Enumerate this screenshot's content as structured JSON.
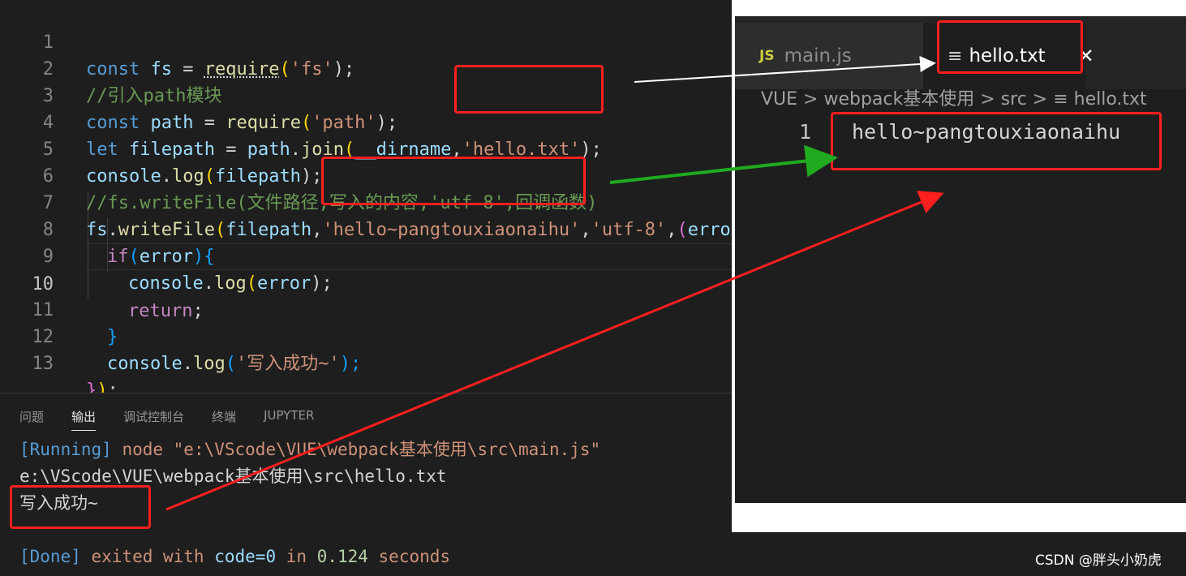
{
  "editor": {
    "line_numbers": [
      "1",
      "2",
      "3",
      "4",
      "5",
      "6",
      "7",
      "8",
      "9",
      "10",
      "11",
      "12",
      "13"
    ],
    "lines": {
      "l1": {
        "kw": "const",
        "var": "fs",
        "op": " = ",
        "fn": "require",
        "open": "(",
        "str": "'fs'",
        "close": ");"
      },
      "l2": {
        "comment": "//引入path模块"
      },
      "l3": {
        "kw": "const",
        "var": "path",
        "op": " = ",
        "fn": "require",
        "open": "(",
        "str": "'path'",
        "close": ");"
      },
      "l4": {
        "kw": "let",
        "var": "filepath",
        "op": " = ",
        "obj": "path",
        "dot": ".",
        "fn": "join",
        "open": "(",
        "arg": "__dirname",
        "comma": ",",
        "str": "'hello.txt'",
        "close": ");"
      },
      "l5": {
        "obj": "console",
        "dot": ".",
        "fn": "log",
        "open": "(",
        "arg": "filepath",
        "close": ");"
      },
      "l6": {
        "comment": "//fs.writeFile(文件路径,写入的内容,'utf-8',回调函数)"
      },
      "l7": {
        "obj": "fs",
        "dot": ".",
        "fn": "writeFile",
        "open": "(",
        "arg": "filepath",
        "comma": ",",
        "str": "'hello~pangtouxiaonaihu'",
        "comma2": ",",
        "str2": "'utf-8'",
        "comma3": ",",
        "paren": "(",
        "arg2": "error"
      },
      "l8": {
        "kw": "if",
        "open": "(",
        "arg": "error",
        "close": ")",
        "brace": "{"
      },
      "l9": {
        "obj": "console",
        "dot": ".",
        "fn": "log",
        "open": "(",
        "arg": "error",
        "close": ");"
      },
      "l10": {
        "kw": "return",
        "semi": ";"
      },
      "l11": {
        "brace": "}"
      },
      "l12": {
        "obj": "console",
        "dot": ".",
        "fn": "log",
        "open": "(",
        "str": "'写入成功~'",
        "close": ");"
      },
      "l13": {
        "brace": "}",
        "paren": ")",
        "semi": ";"
      }
    }
  },
  "panel": {
    "tabs": [
      "问题",
      "输出",
      "调试控制台",
      "终端",
      "JUPYTER"
    ],
    "active_tab": "输出",
    "output": {
      "running_tag": "[Running]",
      "running_cmd": " node \"e:\\VScode\\VUE\\webpack基本使用\\src\\main.js\"",
      "path_line": "e:\\VScode\\VUE\\webpack基本使用\\src\\hello.txt",
      "success_line": "写入成功~",
      "done_tag": "[Done]",
      "done_text1": " exited with ",
      "done_code": "code=0",
      "done_text2": " in ",
      "done_time": "0.124",
      "done_text3": " seconds"
    }
  },
  "right": {
    "tab_inactive": {
      "icon": "JS",
      "label": "main.js"
    },
    "tab_active": {
      "icon": "≡",
      "label": "hello.txt",
      "close": "✕"
    },
    "breadcrumb": "VUE > webpack基本使用 > src > ≡ hello.txt",
    "file_line_number": "1",
    "file_content": "hello~pangtouxiaonaihu"
  },
  "watermark": "CSDN @胖头小奶虎",
  "colors": {
    "annotation_red": "#ff1f1f",
    "arrow_green": "#1faa1f",
    "arrow_white": "#ffffff"
  }
}
